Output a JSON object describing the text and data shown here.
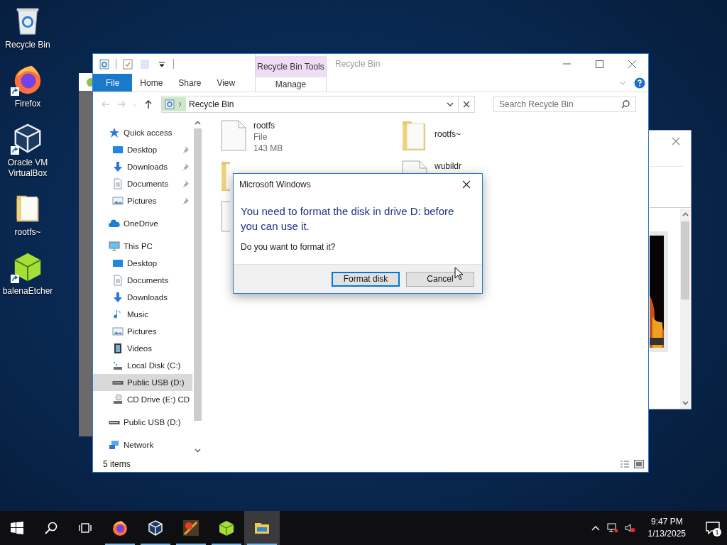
{
  "desktop_icons": [
    {
      "label": "Recycle Bin",
      "kind": "recycle-bin",
      "shortcut": false
    },
    {
      "label": "Firefox",
      "kind": "firefox",
      "shortcut": true
    },
    {
      "label": "Oracle VM VirtualBox",
      "kind": "virtualbox",
      "shortcut": true
    },
    {
      "label": "rootfs~",
      "kind": "folder",
      "shortcut": false
    },
    {
      "label": "balenaEtcher",
      "kind": "etcher",
      "shortcut": true
    }
  ],
  "explorer": {
    "title": "Recycle Bin",
    "ribbon_tabs": [
      {
        "label": "File",
        "kind": "file"
      },
      {
        "label": "Home",
        "kind": "tab"
      },
      {
        "label": "Share",
        "kind": "tab"
      },
      {
        "label": "View",
        "kind": "tab"
      }
    ],
    "contextual_group": {
      "title": "Recycle Bin Tools",
      "tabs": [
        "Manage"
      ]
    },
    "address": "Recycle Bin",
    "search": {
      "placeholder": "Search Recycle Bin"
    },
    "nav": [
      {
        "label": "Quick access",
        "kind": "star",
        "selected": false,
        "children": [
          {
            "label": "Desktop",
            "kind": "desktop",
            "selected": false,
            "pinned": true
          },
          {
            "label": "Downloads",
            "kind": "download",
            "selected": false,
            "pinned": true
          },
          {
            "label": "Documents",
            "kind": "document",
            "selected": false,
            "pinned": true
          },
          {
            "label": "Pictures",
            "kind": "pictures",
            "selected": false,
            "pinned": true
          }
        ]
      },
      {
        "label": "OneDrive",
        "kind": "cloud",
        "selected": false
      },
      {
        "label": "This PC",
        "kind": "pc",
        "selected": false,
        "children": [
          {
            "label": "Desktop",
            "kind": "desktop",
            "selected": false
          },
          {
            "label": "Documents",
            "kind": "document",
            "selected": false
          },
          {
            "label": "Downloads",
            "kind": "download",
            "selected": false
          },
          {
            "label": "Music",
            "kind": "music",
            "selected": false
          },
          {
            "label": "Pictures",
            "kind": "pictures",
            "selected": false
          },
          {
            "label": "Videos",
            "kind": "video",
            "selected": false
          },
          {
            "label": "Local Disk (C:)",
            "kind": "system-drive",
            "selected": false
          },
          {
            "label": "Public USB (D:)",
            "kind": "drive",
            "selected": true
          },
          {
            "label": "CD Drive (E:) CD",
            "kind": "cd",
            "selected": false
          }
        ]
      },
      {
        "label": "Public USB (D:)",
        "kind": "drive",
        "selected": false
      },
      {
        "label": "Network",
        "kind": "network",
        "selected": false
      }
    ],
    "files": [
      {
        "name": "rootfs",
        "type": "File",
        "size": "143 MB",
        "kind": "file"
      },
      {
        "name": "rootfs~",
        "kind": "folder"
      },
      {
        "kind": "folder"
      },
      {
        "name": "wubildr",
        "kind": "file"
      },
      {
        "kind": "file"
      }
    ],
    "status_bar": "5 items"
  },
  "dialog": {
    "title": "Microsoft Windows",
    "heading": "You need to format the disk in drive D: before you can use it.",
    "message": "Do you want to format it?",
    "buttons": [
      {
        "label": "Format disk",
        "kind": "default"
      },
      {
        "label": "Cancel",
        "kind": "normal"
      }
    ]
  },
  "taskbar": {
    "apps": [
      {
        "kind": "firefox",
        "selected": false
      },
      {
        "kind": "virtualbox",
        "selected": false
      },
      {
        "kind": "orange-app",
        "selected": false
      },
      {
        "kind": "etcher",
        "selected": false
      },
      {
        "kind": "explorer",
        "selected": true
      }
    ],
    "time": "9:47 PM",
    "date": "1/13/2025",
    "notifications": "1"
  }
}
